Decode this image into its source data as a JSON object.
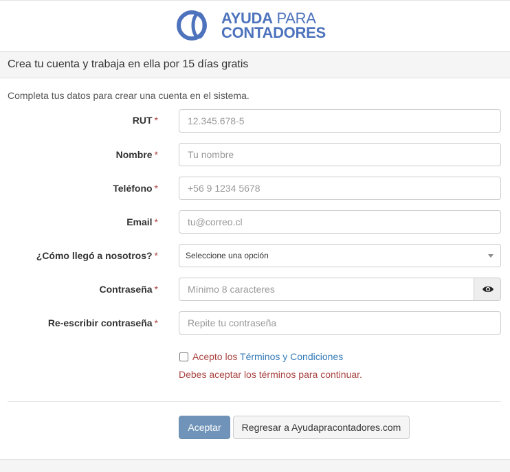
{
  "logo": {
    "word1": "AYUDA",
    "word2": "PARA",
    "word3": "CONTADORES"
  },
  "header": {
    "title": "Crea tu cuenta y trabaja en ella por 15 días gratis"
  },
  "intro": "Completa tus datos para crear una cuenta en el sistema.",
  "required_marker": "*",
  "fields": {
    "rut": {
      "label": "RUT",
      "placeholder": "12.345.678-5"
    },
    "nombre": {
      "label": "Nombre",
      "placeholder": "Tu nombre"
    },
    "telefono": {
      "label": "Teléfono",
      "placeholder": "+56 9 1234 5678"
    },
    "email": {
      "label": "Email",
      "placeholder": "tu@correo.cl"
    },
    "como": {
      "label": "¿Cómo llegó a nosotros?",
      "selected": "Seleccione una opción"
    },
    "password": {
      "label": "Contraseña",
      "placeholder": "Mínimo 8 caracteres"
    },
    "password2": {
      "label": "Re-escribir contraseña",
      "placeholder": "Repite tu contraseña"
    }
  },
  "terms": {
    "prefix": "Acepto los",
    "link": "Términos y Condiciones",
    "error": "Debes aceptar los términos para continuar."
  },
  "buttons": {
    "submit": "Aceptar",
    "back": "Regresar a Ayudapracontadores.com"
  },
  "colors": {
    "brand": "#4e73bd",
    "error": "#a94442",
    "link": "#337ab7",
    "primary": "#7094b9"
  },
  "icons": {
    "logo": "ring-logo-icon",
    "eye": "eye-icon",
    "select": "caret-down-icon"
  }
}
